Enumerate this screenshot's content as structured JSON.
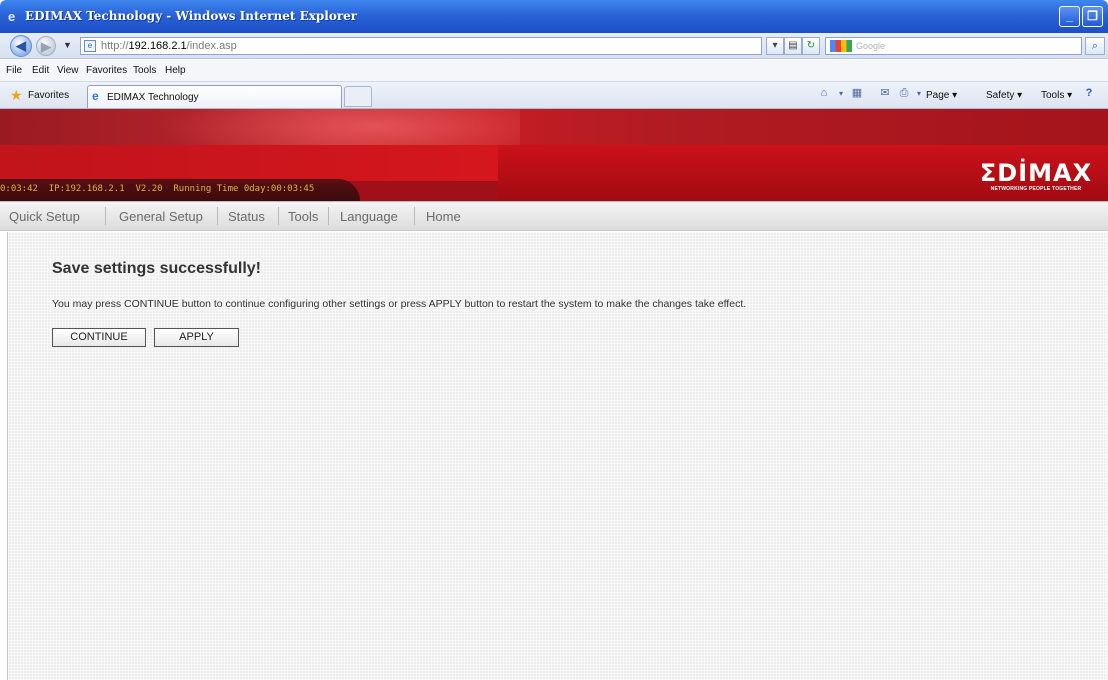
{
  "window": {
    "title": "EDIMAX Technology - Windows Internet Explorer",
    "min_symbol": "_",
    "max_symbol": "❐",
    "close_symbol": "✕"
  },
  "address_bar": {
    "url_prefix": "http://",
    "url_host": "192.168.2.1",
    "url_path": "/index.asp",
    "search_placeholder": "Google",
    "refresh_symbol": "↻",
    "stop_symbol": "✕",
    "compat_symbol": "▤",
    "dropdown_symbol": "▾",
    "search_symbol": "⌕"
  },
  "menu": {
    "file": "File",
    "edit": "Edit",
    "view": "View",
    "favorites": "Favorites",
    "tools": "Tools",
    "help": "Help"
  },
  "favorites_bar": {
    "favorites_label": "Favorites",
    "tab_label": "EDIMAX Technology",
    "page_menu": "Page ▾",
    "safety_menu": "Safety ▾",
    "tools_menu": "Tools ▾"
  },
  "header": {
    "status_line": "0:03:42  IP:192.168.2.1  V2.20  Running Time 0day:00:03:45",
    "logo_text": "ΣDİMAX",
    "logo_tagline": "NETWORKING PEOPLE TOGETHER"
  },
  "nav": {
    "quick_setup": "Quick Setup",
    "general_setup": "General Setup",
    "status": "Status",
    "tools": "Tools",
    "language": "Language",
    "home": "Home"
  },
  "content": {
    "heading": "Save settings successfully!",
    "message": "You may press CONTINUE button to continue configuring other settings or press APPLY button to restart the system to make the changes take effect.",
    "continue_label": "CONTINUE",
    "apply_label": "APPLY"
  }
}
